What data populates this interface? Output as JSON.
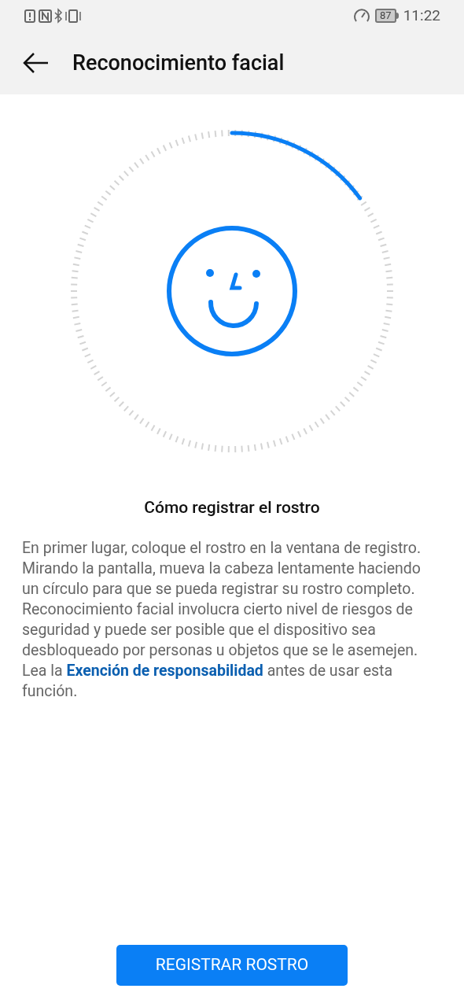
{
  "status_bar": {
    "battery": "87",
    "time": "11:22"
  },
  "app_bar": {
    "title": "Reconocimiento facial"
  },
  "heading": "Cómo registrar el rostro",
  "paragraphs": [
    {
      "text": "En primer lugar, coloque el rostro en la ventana de registro. Mirando la pantalla, mueva la cabeza lentamente haciendo un círculo para que se pueda registrar su rostro completo."
    },
    {
      "text": "Reconocimiento facial involucra cierto nivel de riesgos de seguridad y puede ser posible que el dispositivo sea desbloqueado por personas u objetos que se le asemejen. Lea la",
      "link": "Exención de responsabilidad",
      "after": "antes de usar esta función."
    }
  ],
  "button": "REGISTRAR ROSTRO"
}
